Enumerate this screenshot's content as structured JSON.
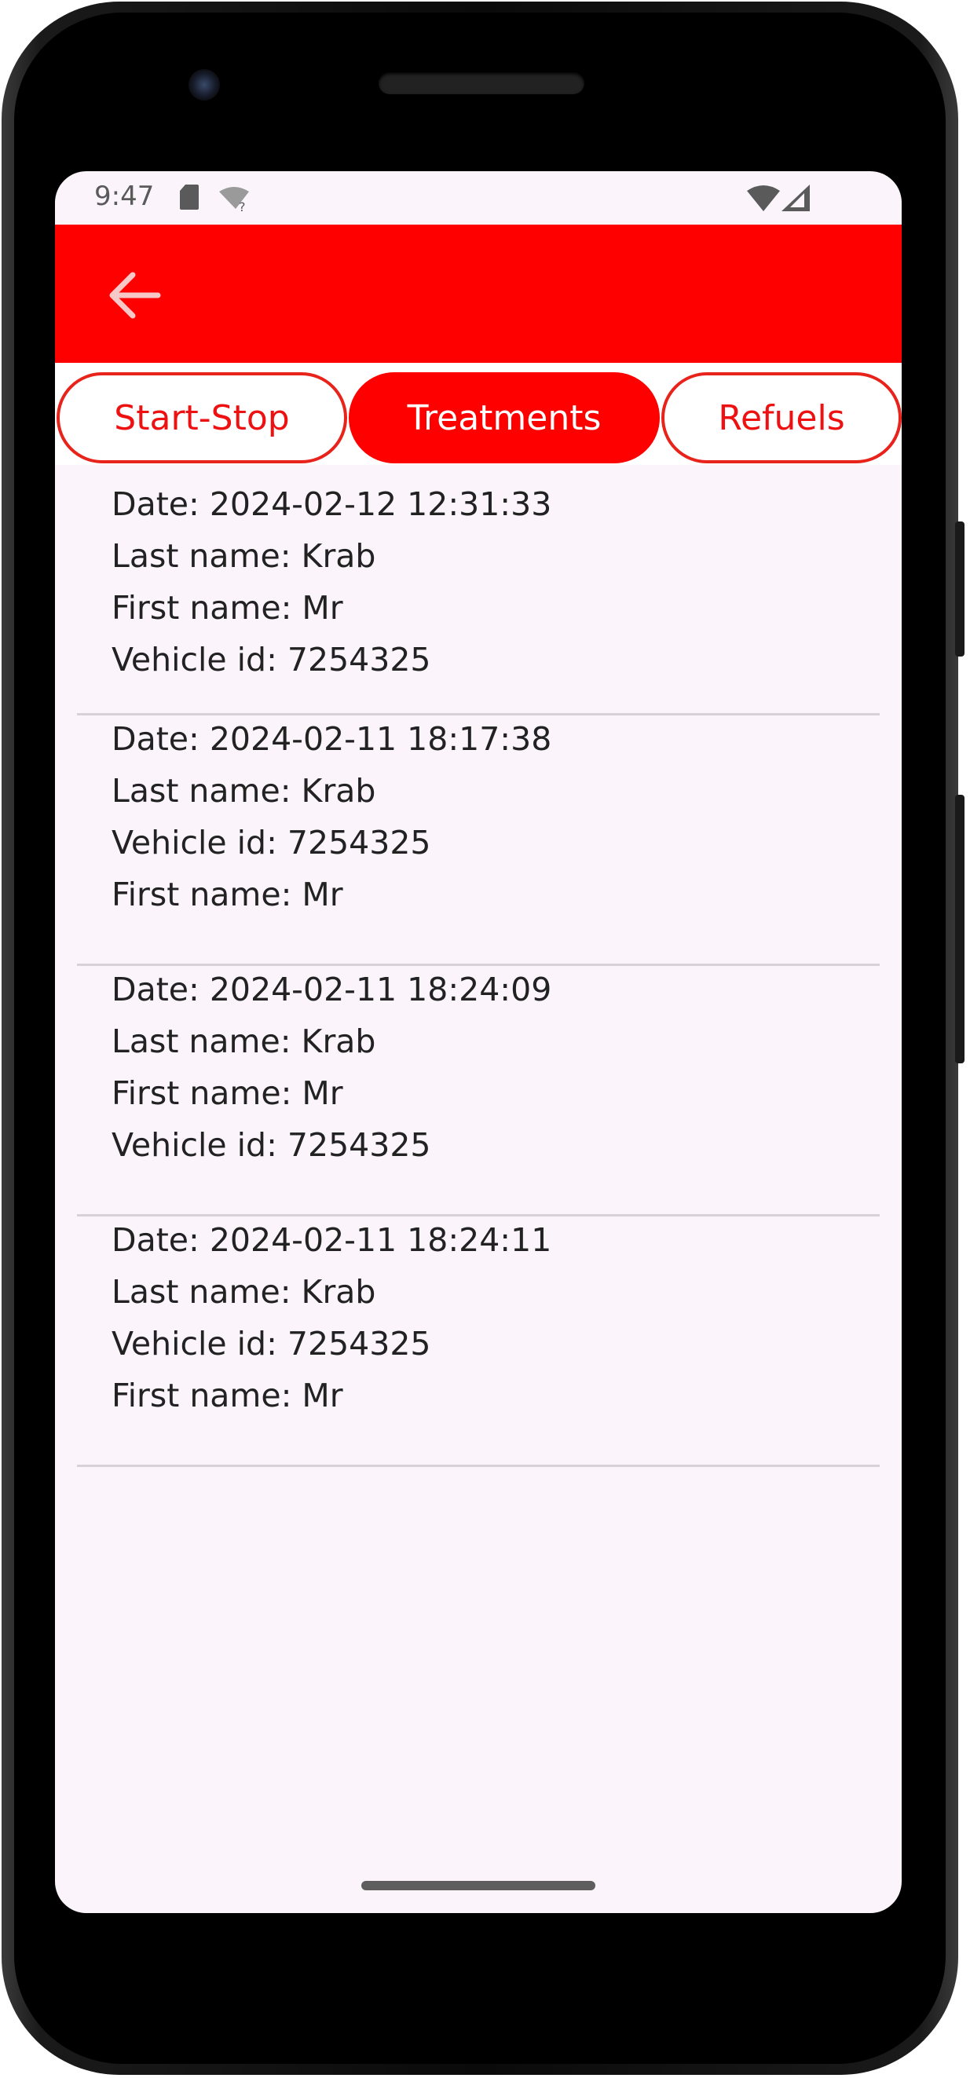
{
  "status_bar": {
    "time": "9:47",
    "icons": [
      "sd-card-icon",
      "wifi-unknown-icon",
      "wifi-icon",
      "cell-signal-icon"
    ]
  },
  "app_bar": {
    "back_icon": "arrow-back-icon",
    "color": "#ff0000"
  },
  "tabs": [
    {
      "label": "Start-Stop",
      "active": false
    },
    {
      "label": "Treatments",
      "active": true
    },
    {
      "label": "Refuels",
      "active": false
    }
  ],
  "records": [
    {
      "lines": [
        "Date: 2024-02-12 12:31:33",
        "Last name: Krab",
        "First name: Mr",
        "Vehicle id: 7254325"
      ]
    },
    {
      "lines": [
        "Date: 2024-02-11 18:17:38",
        "Last name: Krab",
        "Vehicle id: 7254325",
        "First name: Mr"
      ]
    },
    {
      "lines": [
        "Date: 2024-02-11 18:24:09",
        "Last name: Krab",
        "First name: Mr",
        "Vehicle id: 7254325"
      ]
    },
    {
      "lines": [
        "Date: 2024-02-11 18:24:11",
        "Last name: Krab",
        "Vehicle id: 7254325",
        "First name: Mr"
      ]
    }
  ]
}
